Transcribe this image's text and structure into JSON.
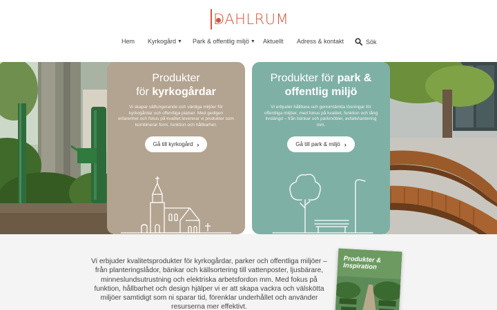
{
  "brand": {
    "name": "DAHLRUM",
    "color": "#d4553a"
  },
  "nav": {
    "items": [
      {
        "label": "Hem"
      },
      {
        "label": "Kyrkogård",
        "dropdown": true
      },
      {
        "label": "Park & offentlig miljö",
        "dropdown": true
      },
      {
        "label": "Aktuellt"
      },
      {
        "label": "Adress & kontakt"
      }
    ],
    "search_label": "Sök"
  },
  "cards": {
    "left": {
      "title_line1": "Produkter",
      "title_pre": "för ",
      "title_bold": "kyrkogårdar",
      "description": "Vi skapar välfungerande och värdiga miljöer för kyrkogårdar och offentliga platser. Med gedigen erfarenhet och fokus på kvalitet levererar vi produkter som kombinerar form, funktion och hållbarhet.",
      "button_label": "Gå till kyrkogård",
      "color": "#b3a491"
    },
    "right": {
      "title_line1_pre": "Produkter för ",
      "title_line1_bold": "park &",
      "title_line2_bold": "offentlig miljö",
      "description": "Vi erbjuder hållbara och genomtänkta lösningar för offentliga miljöer, med fokus på kvalitet, funktion och lång livslängd – från bänkar och parkmöbler, avfallshantering mm.",
      "button_label": "Gå till park & miljö",
      "color": "#7fb0a6"
    }
  },
  "intro": {
    "text": "Vi erbjuder kvalitetsprodukter för kyrkogårdar, parker och offentliga miljöer – från planteringslådor, bänkar och källsortering till vattenposter, ljusbärare, minneslundsutrustning och elektriska arbetsfordon mm. Med fokus på funktion, hållbarhet och design hjälper vi er att skapa vackra och välskötta miljöer samtidigt som ni sparar tid, förenklar underhållet och använder resurserna mer effektivt."
  },
  "brochure": {
    "title": "Produkter & Inspiration"
  }
}
